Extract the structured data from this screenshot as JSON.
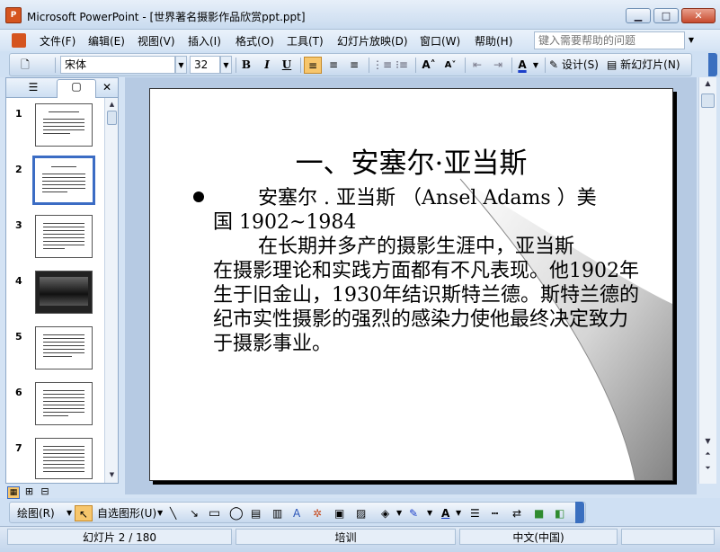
{
  "window": {
    "app_icon_label": "P",
    "title": "Microsoft PowerPoint - [世界著名摄影作品欣赏ppt.ppt]",
    "min_glyph": "▁",
    "max_glyph": "□",
    "close_glyph": "✕"
  },
  "menu": {
    "items": [
      "文件(F)",
      "编辑(E)",
      "视图(V)",
      "插入(I)",
      "格式(O)",
      "工具(T)",
      "幻灯片放映(D)",
      "窗口(W)",
      "帮助(H)"
    ],
    "help_placeholder": "键入需要帮助的问题"
  },
  "toolbar": {
    "font_name": "宋体",
    "font_size": "32",
    "bold": "B",
    "italic": "I",
    "underline": "U",
    "grow_font": "A˄",
    "shrink_font": "A˅",
    "font_color": "A",
    "design_label": "设计(S)",
    "new_slide_label": "新幻灯片(N)"
  },
  "slides_panel": {
    "tab_outline": "☰",
    "tab_slides": "▢",
    "close": "✕",
    "thumb_numbers": [
      "1",
      "2",
      "3",
      "4",
      "5",
      "6",
      "7"
    ],
    "selected": 2
  },
  "slide": {
    "title": "一、安塞尔·亚当斯",
    "para1_line1": "安塞尔 . 亚当斯 （Ansel Adams ）美",
    "para1_line2": "国 1902~1984",
    "para2_line1": "在长期并多产的摄影生涯中，亚当斯",
    "para2_rest": "在摄影理论和实践方面都有不凡表现。他1902年生于旧金山，1930年结识斯特兰德。斯特兰德的纪市实性摄影的强烈的感染力使他最终决定致力于摄影事业。"
  },
  "drawing_toolbar": {
    "draw_label": "绘图(R)",
    "autoshape_label": "自选图形(U)"
  },
  "status": {
    "slide_info": "幻灯片 2 / 180",
    "design": "培训",
    "language": "中文(中国)"
  },
  "colors": {
    "accent": "#3b6cc4",
    "titlebar": "#c9dbef",
    "active_button": "#f7c66c"
  }
}
